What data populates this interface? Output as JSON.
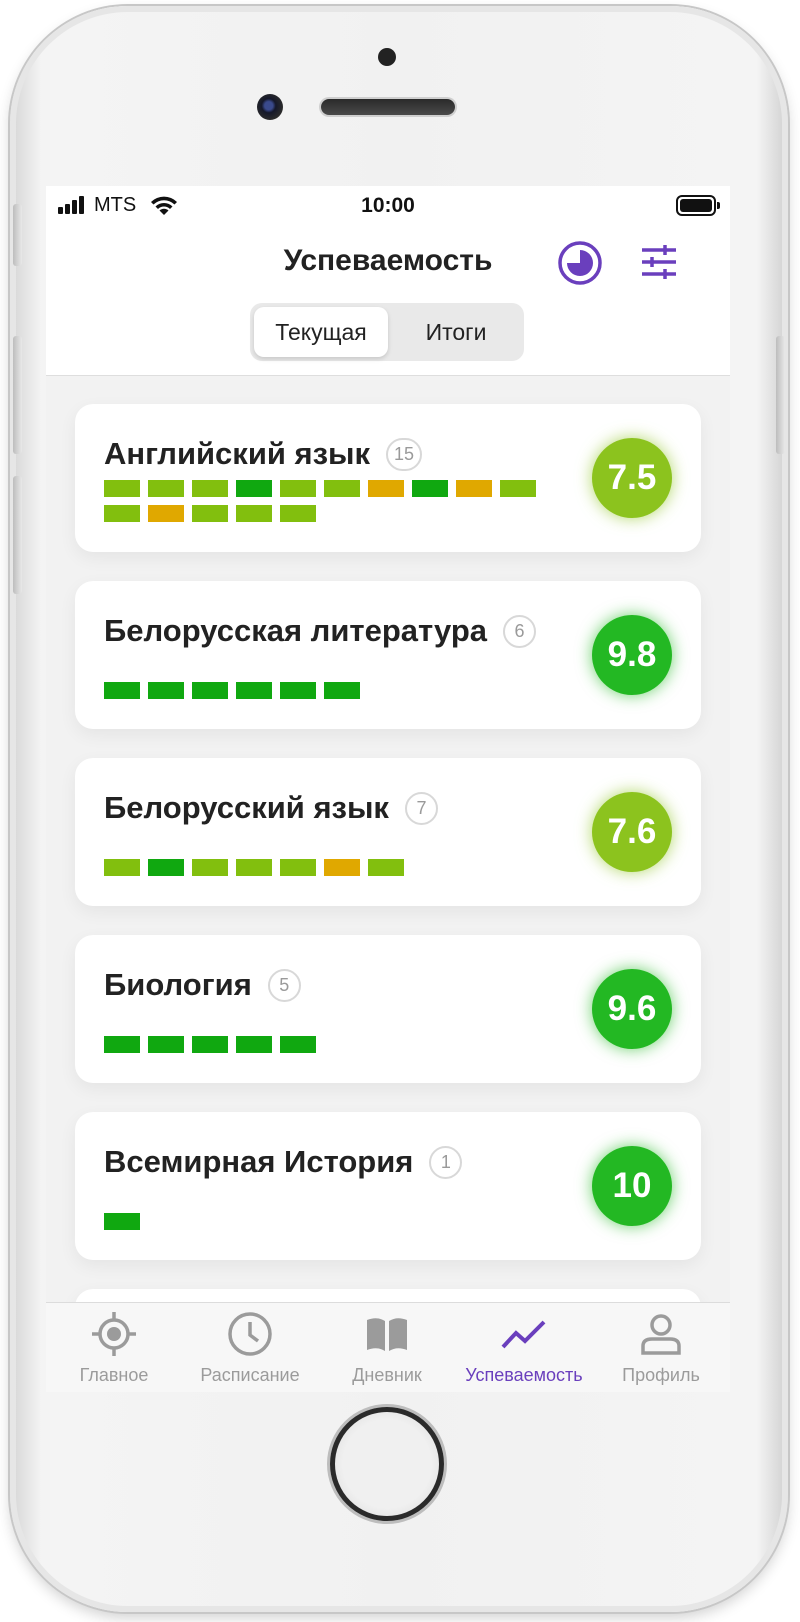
{
  "status": {
    "carrier": "MTS",
    "time": "10:00"
  },
  "header": {
    "title": "Успеваемость",
    "segments": [
      "Текущая",
      "Итоги"
    ],
    "active_segment": 0
  },
  "colors": {
    "accent": "#6a3fbd",
    "grade_excellent": "#10a810",
    "grade_good": "#82bf0e",
    "grade_average": "#e0a800",
    "score_high": "#23b823",
    "score_mid": "#8cc31e"
  },
  "subjects": [
    {
      "name": "Английский язык",
      "count": "15",
      "score": "7.5",
      "score_level": "mid",
      "marks": [
        "good",
        "good",
        "good",
        "excellent",
        "good",
        "good",
        "average",
        "excellent",
        "average",
        "good",
        "good",
        "average",
        "good",
        "good",
        "good"
      ]
    },
    {
      "name": "Белорусская литература",
      "count": "6",
      "score": "9.8",
      "score_level": "high",
      "marks": [
        "excellent",
        "excellent",
        "excellent",
        "excellent",
        "excellent",
        "excellent"
      ]
    },
    {
      "name": "Белорусский язык",
      "count": "7",
      "score": "7.6",
      "score_level": "mid",
      "marks": [
        "good",
        "excellent",
        "good",
        "good",
        "good",
        "average",
        "good"
      ]
    },
    {
      "name": "Биология",
      "count": "5",
      "score": "9.6",
      "score_level": "high",
      "marks": [
        "excellent",
        "excellent",
        "excellent",
        "excellent",
        "excellent"
      ]
    },
    {
      "name": "Всемирная История",
      "count": "1",
      "score": "10",
      "score_level": "high",
      "marks": [
        "excellent"
      ]
    }
  ],
  "tabs": [
    {
      "label": "Главное",
      "icon": "target-icon"
    },
    {
      "label": "Расписание",
      "icon": "clock-icon"
    },
    {
      "label": "Дневник",
      "icon": "book-icon"
    },
    {
      "label": "Успеваемость",
      "icon": "trend-icon",
      "active": true
    },
    {
      "label": "Профиль",
      "icon": "user-icon"
    }
  ]
}
